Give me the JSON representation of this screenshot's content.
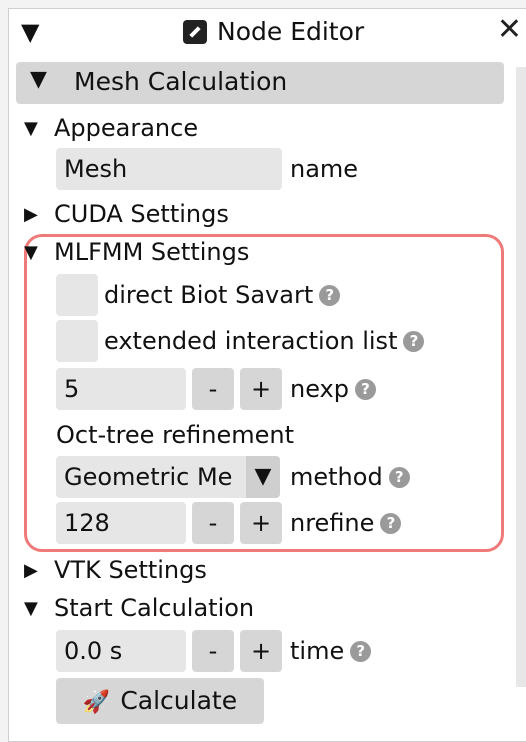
{
  "window": {
    "title": "Node Editor",
    "toggle_glyph": "▼",
    "close_glyph": "✕"
  },
  "section": {
    "label": "Mesh Calculation",
    "arrow": "▼"
  },
  "appearance": {
    "label": "Appearance",
    "arrow": "▼",
    "name_value": "Mesh",
    "name_label": "name"
  },
  "cuda": {
    "label": "CUDA Settings",
    "arrow": "▶"
  },
  "mlfmm": {
    "label": "MLFMM Settings",
    "arrow": "▼",
    "direct_label": "direct Biot Savart",
    "extended_label": "extended interaction list",
    "nexp_value": "5",
    "nexp_label": "nexp",
    "octree_label": "Oct-tree refinement",
    "method_value": "Geometric Me",
    "method_label": "method",
    "nrefine_value": "128",
    "nrefine_label": "nrefine"
  },
  "vtk": {
    "label": "VTK Settings",
    "arrow": "▶"
  },
  "start": {
    "label": "Start Calculation",
    "arrow": "▼",
    "time_value": "0.0 s",
    "time_label": "time"
  },
  "buttons": {
    "minus": "-",
    "plus": "+",
    "calculate": "Calculate",
    "help": "?",
    "dropdown": "▼"
  },
  "icons": {
    "edit": "edit-icon",
    "rocket": "rocket-icon",
    "help": "help-icon"
  },
  "colors": {
    "highlight": "#f07a7a",
    "header_bg": "#d6d6d6",
    "field_bg": "#e6e6e6"
  }
}
